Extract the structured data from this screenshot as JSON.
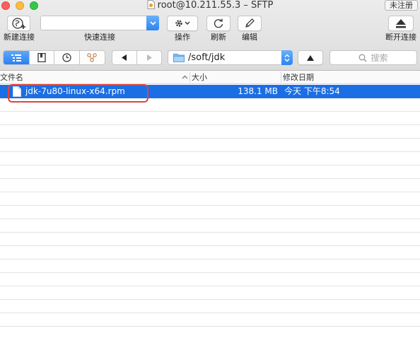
{
  "window": {
    "title": "root@10.211.55.3 – SFTP",
    "unregistered_label": "未注册"
  },
  "toolbar": {
    "new_connection_label": "新建连接",
    "quick_connect_label": "快速连接",
    "quick_connect_value": "",
    "actions_label": "操作",
    "refresh_label": "刷新",
    "edit_label": "编辑",
    "disconnect_label": "断开连接"
  },
  "navbar": {
    "path": "/soft/jdk",
    "search_placeholder": "搜索"
  },
  "columns": {
    "name": "文件名",
    "size": "大小",
    "modified": "修改日期"
  },
  "files": [
    {
      "name": "jdk-7u80-linux-x64.rpm",
      "size": "138.1 MB",
      "modified": "今天 下午8:54",
      "selected": true
    }
  ],
  "colors": {
    "selection": "#1b6ee3",
    "highlight_border": "#e0443e",
    "accent": "#2b84f3"
  }
}
